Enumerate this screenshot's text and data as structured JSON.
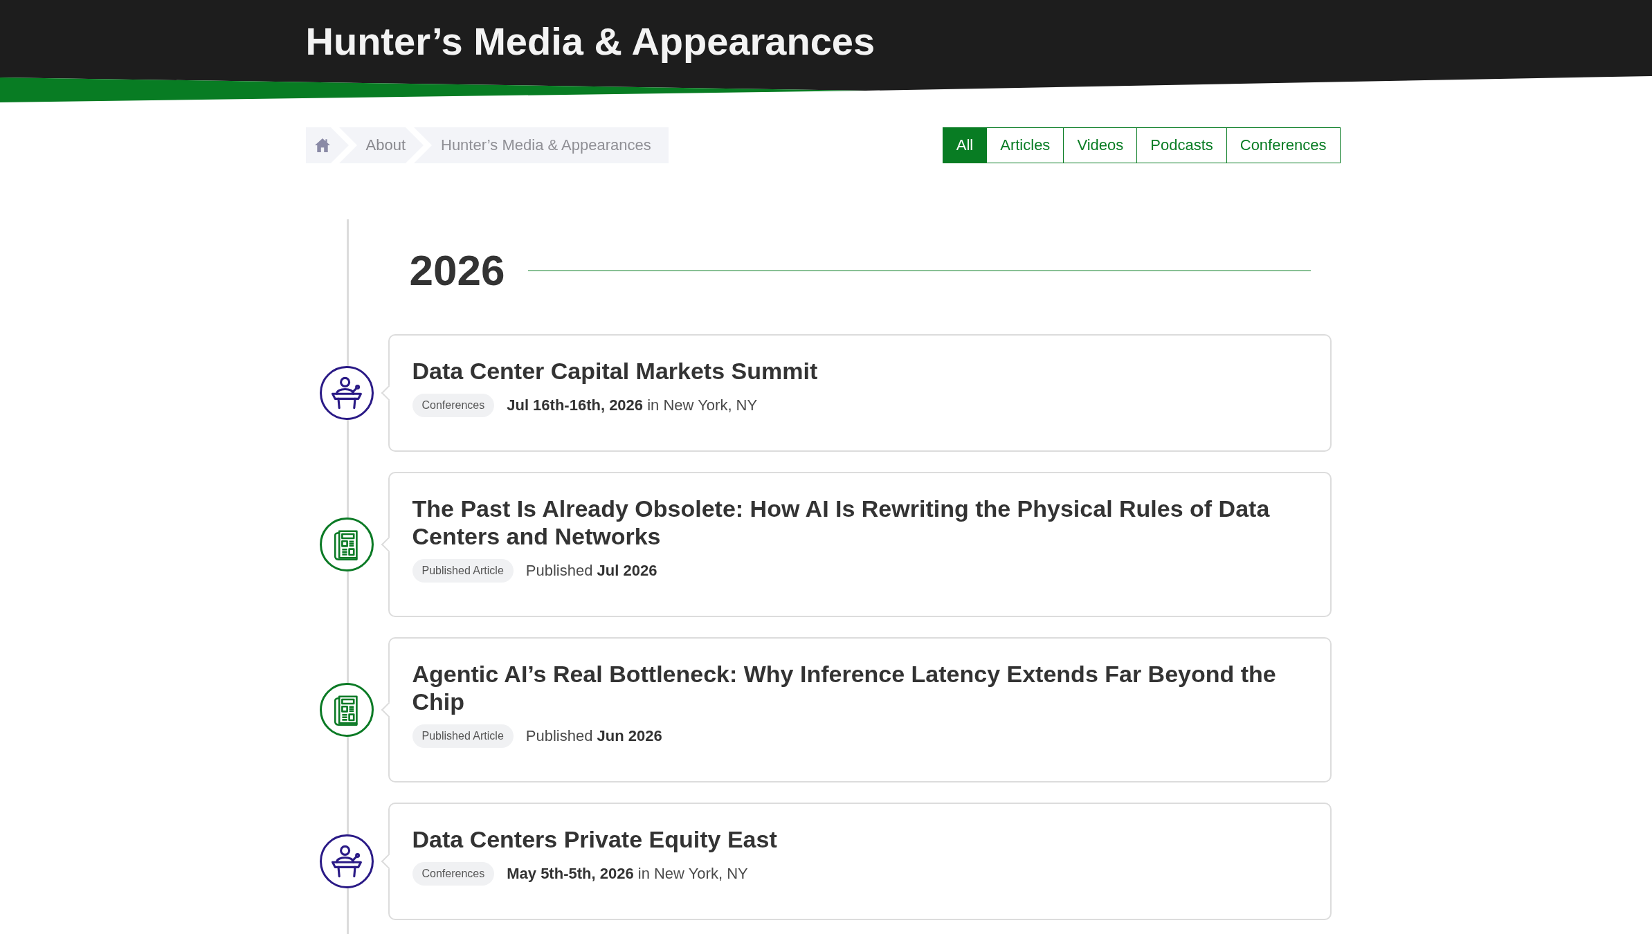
{
  "header": {
    "title": "Hunter’s Media & Appearances"
  },
  "breadcrumb": {
    "items": [
      {
        "kind": "home"
      },
      {
        "kind": "link",
        "label": "About"
      },
      {
        "kind": "current",
        "label": "Hunter’s Media & Appearances"
      }
    ]
  },
  "filters": [
    {
      "label": "All",
      "selected": true
    },
    {
      "label": "Articles",
      "selected": false
    },
    {
      "label": "Videos",
      "selected": false
    },
    {
      "label": "Podcasts",
      "selected": false
    },
    {
      "label": "Conferences",
      "selected": false
    }
  ],
  "timeline": {
    "year": "2026",
    "entries": [
      {
        "kind": "conference",
        "title": "Data Center Capital Markets Summit",
        "tag": "Conferences",
        "meta": "**Jul 16th-16th, 2026** in New York, NY"
      },
      {
        "kind": "article",
        "title": "The Past Is Already Obsolete: How AI Is Rewriting the Physical Rules of Data Centers and Networks",
        "tag": "Published Article",
        "meta": "Published **Jul 2026**"
      },
      {
        "kind": "article",
        "title": "Agentic AI’s Real Bottleneck: Why Inference Latency Extends Far Beyond the Chip",
        "tag": "Published Article",
        "meta": "Published **Jun 2026**"
      },
      {
        "kind": "conference",
        "title": "Data Centers Private Equity East",
        "tag": "Conferences",
        "meta": "**May 5th-5th, 2026** in New York, NY"
      }
    ]
  }
}
